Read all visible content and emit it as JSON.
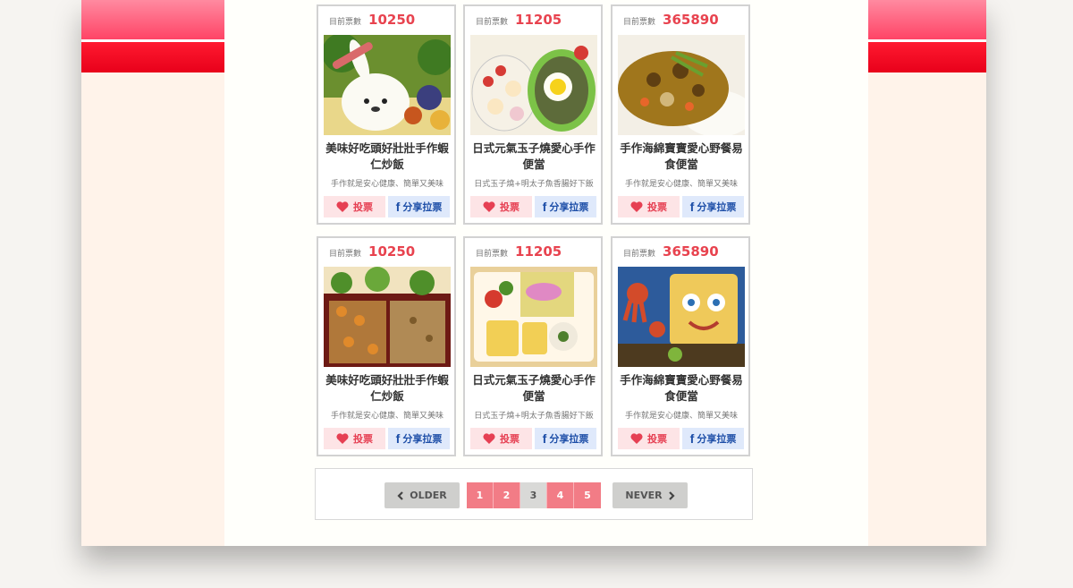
{
  "cards": [
    {
      "count_label": "目前票數",
      "count": "10250",
      "title": "美味好吃頭好壯壯手作蝦仁炒飯",
      "desc": "手作就是安心健康、簡單又美味",
      "vote_label": "投票",
      "share_label": "分享拉票",
      "photo": "rabbit-rice-bento"
    },
    {
      "count_label": "目前票數",
      "count": "11205",
      "title": "日式元氣玉子燒愛心手作便當",
      "desc": "日式玉子燒+明太子魚香腸好下飯",
      "vote_label": "投票",
      "share_label": "分享拉票",
      "photo": "egg-face-bento"
    },
    {
      "count_label": "目前票數",
      "count": "365890",
      "title": "手作海綿寶寶愛心野餐易食便當",
      "desc": "手作就是安心健康、簡單又美味",
      "vote_label": "投票",
      "share_label": "分享拉票",
      "photo": "curry-rice"
    },
    {
      "count_label": "目前票數",
      "count": "10250",
      "title": "美味好吃頭好壯壯手作蝦仁炒飯",
      "desc": "手作就是安心健康、簡單又美味",
      "vote_label": "投票",
      "share_label": "分享拉票",
      "photo": "fried-rice-bento"
    },
    {
      "count_label": "目前票數",
      "count": "11205",
      "title": "日式元氣玉子燒愛心手作便當",
      "desc": "日式玉子燒+明太子魚香腸好下飯",
      "vote_label": "投票",
      "share_label": "分享拉票",
      "photo": "tamagoyaki-bento"
    },
    {
      "count_label": "目前票數",
      "count": "365890",
      "title": "手作海綿寶寶愛心野餐易食便當",
      "desc": "手作就是安心健康、簡單又美味",
      "vote_label": "投票",
      "share_label": "分享拉票",
      "photo": "spongebob-bento"
    }
  ],
  "pagination": {
    "older_label": "OLDER",
    "never_label": "NEVER",
    "pages": [
      "1",
      "2",
      "3",
      "4",
      "5"
    ],
    "current": "3"
  },
  "colors": {
    "accent": "#e8434f",
    "vote_bg": "#fde4e6",
    "share_bg": "#dfe9fb",
    "page_active": "#f27c86",
    "band_red": "#ff1a30"
  }
}
